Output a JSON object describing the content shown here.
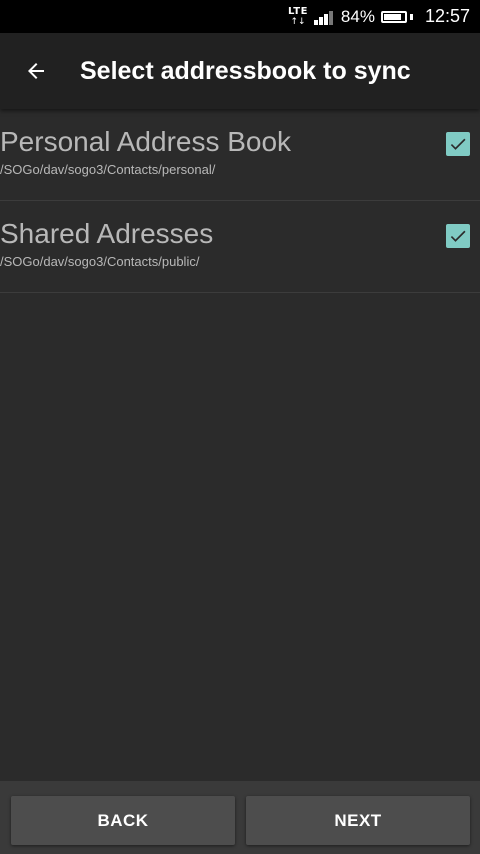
{
  "status_bar": {
    "network": "LTE",
    "battery_percent": "84%",
    "battery_level": 0.84,
    "time": "12:57",
    "icons": [
      "lte-icon",
      "signal-icon",
      "battery-icon"
    ]
  },
  "app_bar": {
    "back_icon": "arrow-back-icon",
    "title": "Select addressbook to sync"
  },
  "addressbooks": [
    {
      "name": "Personal Address Book",
      "path": "/SOGo/dav/sogo3/Contacts/personal/",
      "checked": true
    },
    {
      "name": "Shared Adresses",
      "path": "/SOGo/dav/sogo3/Contacts/public/",
      "checked": true
    }
  ],
  "footer": {
    "back_label": "BACK",
    "next_label": "NEXT"
  },
  "colors": {
    "accent": "#80cbc4",
    "background": "#2b2b2b",
    "app_bar": "#212121"
  }
}
